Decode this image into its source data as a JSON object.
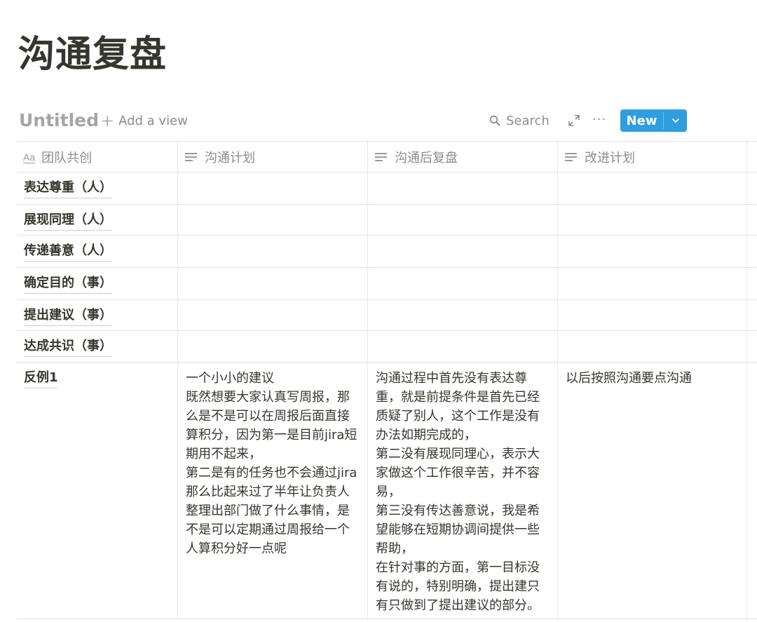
{
  "page": {
    "title": "沟通复盘"
  },
  "toolbar": {
    "db_title": "Untitled",
    "add_view": "Add a view",
    "search": "Search",
    "more": "···",
    "new_label": "New",
    "accent": "#2f9ede"
  },
  "table": {
    "headers": [
      {
        "label": "团队共创",
        "icon": "aa-title-icon"
      },
      {
        "label": "沟通计划",
        "icon": "text-lines-icon"
      },
      {
        "label": "沟通后复盘",
        "icon": "text-lines-icon"
      },
      {
        "label": "改进计划",
        "icon": "text-lines-icon"
      }
    ],
    "title_icon_text": "Aa",
    "rows": [
      {
        "name": "表达尊重（人）",
        "plan": "",
        "review": "",
        "improve": ""
      },
      {
        "name": "展现同理（人）",
        "plan": "",
        "review": "",
        "improve": ""
      },
      {
        "name": "传递善意（人）",
        "plan": "",
        "review": "",
        "improve": ""
      },
      {
        "name": "确定目的（事）",
        "plan": "",
        "review": "",
        "improve": ""
      },
      {
        "name": "提出建议（事）",
        "plan": "",
        "review": "",
        "improve": ""
      },
      {
        "name": "达成共识（事）",
        "plan": "",
        "review": "",
        "improve": ""
      },
      {
        "name": "反例1",
        "plan": "一个小小的建议\n既然想要大家认真写周报，那么是不是可以在周报后面直接算积分，因为第一是目前jira短期用不起来，\n第二是有的任务也不会通过jira\n那么比起来过了半年让负责人整理出部门做了什么事情，是不是可以定期通过周报给一个人算积分好一点呢",
        "review": "沟通过程中首先没有表达尊重，就是前提条件是首先已经质疑了别人，这个工作是没有办法如期完成的，\n第二没有展现同理心，表示大家做这个工作很辛苦，并不容易，\n第三没有传达善意说，我是希望能够在短期协调间提供一些帮助，\n在针对事的方面，第一目标没有说的，特别明确，提出建只有只做到了提出建议的部分。",
        "improve": "以后按照沟通要点沟通"
      }
    ]
  }
}
